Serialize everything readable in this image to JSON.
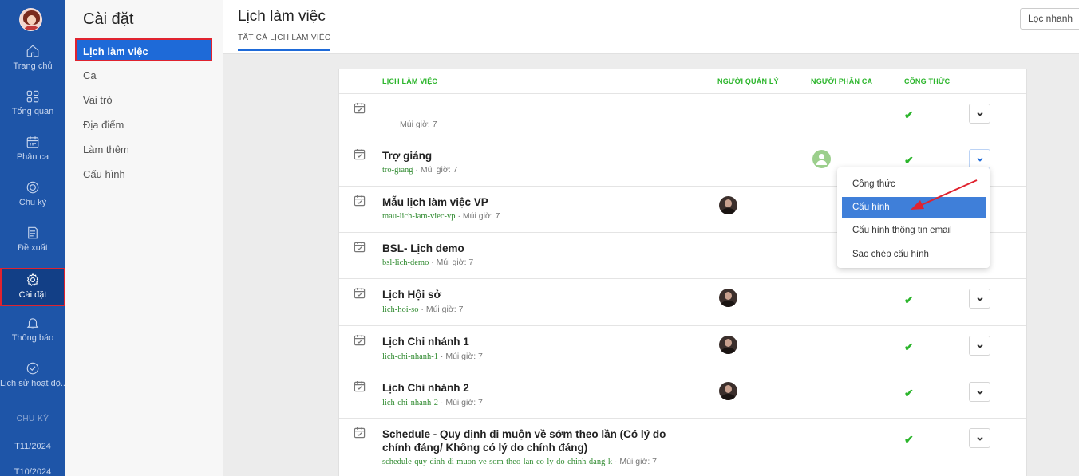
{
  "sidebar": {
    "items": [
      {
        "label": "Trang chủ",
        "icon": "home-icon"
      },
      {
        "label": "Tổng quan",
        "icon": "grid-icon"
      },
      {
        "label": "Phân ca",
        "icon": "calendar-icon"
      },
      {
        "label": "Chu kỳ",
        "icon": "cycle-icon"
      },
      {
        "label": "Đề xuất",
        "icon": "document-icon"
      },
      {
        "label": "Cài đặt",
        "icon": "gear-icon",
        "active": true
      },
      {
        "label": "Thông báo",
        "icon": "bell-icon"
      },
      {
        "label": "Lịch sử hoạt độ...",
        "icon": "check-circle-icon"
      }
    ],
    "section_label": "CHU KỲ",
    "periods": [
      "T11/2024",
      "T10/2024"
    ]
  },
  "settings_menu": {
    "title": "Cài đặt",
    "items": [
      "Lịch làm việc",
      "Ca",
      "Vai trò",
      "Địa điểm",
      "Làm thêm",
      "Cấu hình"
    ],
    "active_index": 0
  },
  "header": {
    "title": "Lịch làm việc",
    "tab": "TẤT CẢ LỊCH LÀM VIỆC",
    "filter_button": "Lọc nhanh"
  },
  "table": {
    "columns": [
      "LỊCH LÀM VIỆC",
      "NGƯỜI QUẢN LÝ",
      "NGƯỜI PHÂN CA",
      "CÔNG THỨC"
    ],
    "rows": [
      {
        "name": "",
        "slug": "",
        "timezone": "Múi giờ: 7",
        "manager": false,
        "assignee": false,
        "formula": true
      },
      {
        "name": "Trợ giảng",
        "slug": "tro-giang",
        "timezone": "Múi giờ: 7",
        "manager": false,
        "assignee": true,
        "formula": true,
        "dropdown_open": true
      },
      {
        "name": "Mẫu lịch làm việc VP",
        "slug": "mau-lich-lam-viec-vp",
        "timezone": "Múi giờ: 7",
        "manager": true,
        "assignee": false,
        "formula": false
      },
      {
        "name": "BSL- Lịch demo",
        "slug": "bsl-lich-demo",
        "timezone": "Múi giờ: 7",
        "manager": false,
        "assignee": false,
        "formula": false
      },
      {
        "name": "Lịch Hội sở",
        "slug": "lich-hoi-so",
        "timezone": "Múi giờ: 7",
        "manager": true,
        "assignee": false,
        "formula": true
      },
      {
        "name": "Lịch Chi nhánh 1",
        "slug": "lich-chi-nhanh-1",
        "timezone": "Múi giờ: 7",
        "manager": true,
        "assignee": false,
        "formula": true
      },
      {
        "name": "Lịch Chi nhánh 2",
        "slug": "lich-chi-nhanh-2",
        "timezone": "Múi giờ: 7",
        "manager": true,
        "assignee": false,
        "formula": true
      },
      {
        "name": "Schedule - Quy định đi muộn về sớm theo lần (Có lý do chính đáng/ Không có lý do chính đáng)",
        "slug": "schedule-quy-dinh-di-muon-ve-som-theo-lan-co-ly-do-chinh-dang-k",
        "timezone": "Múi giờ: 7",
        "manager": false,
        "assignee": false,
        "formula": true
      }
    ]
  },
  "dropdown_menu": {
    "items": [
      "Công thức",
      "Cấu hình",
      "Cấu hình thông tin email",
      "Sao chép cấu hình"
    ],
    "active_index": 1
  },
  "colors": {
    "rail_bg": "#1e55a8",
    "accent": "#1e6ad8",
    "highlight_border": "#e0232f",
    "column_header": "#2bb52b",
    "check": "#2bb52b",
    "menu_active": "#3f7fd9",
    "annotation_arrow": "#e0232f"
  }
}
